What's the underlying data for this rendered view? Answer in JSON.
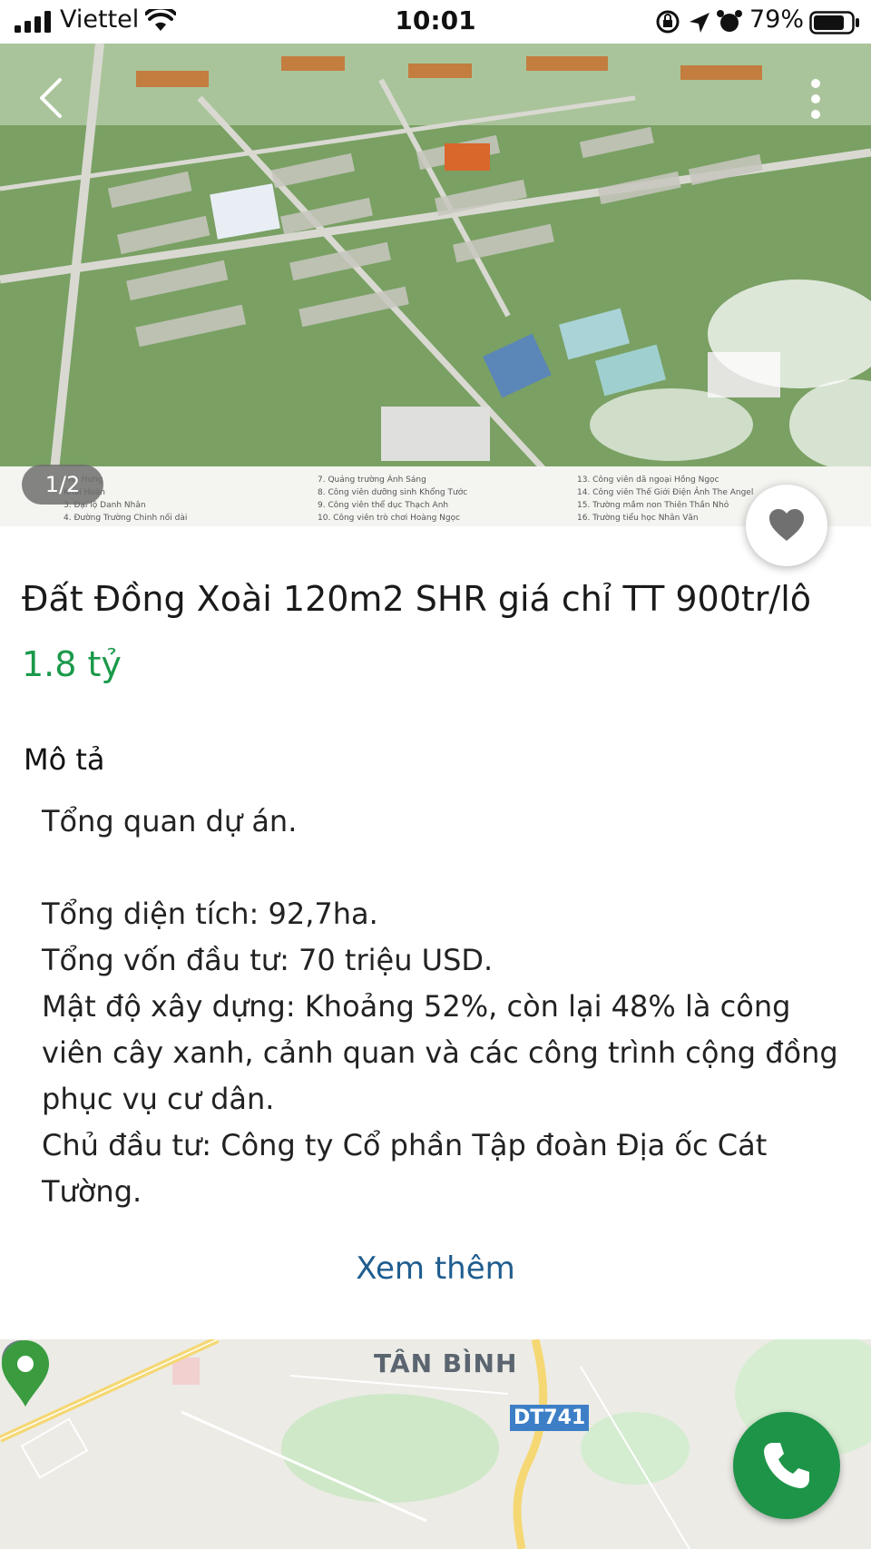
{
  "status_bar": {
    "carrier": "Viettel",
    "time": "10:01",
    "battery_percent": "79%"
  },
  "gallery": {
    "counter": "1/2",
    "legend_left": [
      "Phú Hưng",
      "Khải Hoàn",
      "3. Đại lộ Danh Nhân",
      "4. Đường Trường Chinh nối dài"
    ],
    "legend_mid": [
      "7. Quảng trường Ánh Sáng",
      "8. Công viên dưỡng sinh Khổng Tước",
      "9. Công viên thể dục Thạch Anh",
      "10. Công viên trò chơi Hoàng Ngọc"
    ],
    "legend_right": [
      "13. Công viên dã ngoại Hồng Ngọc",
      "14. Công viên Thế Giới Điện Ảnh The Angel",
      "15. Trường mầm non Thiên Thần Nhỏ",
      "16. Trường tiểu học Nhân Văn"
    ]
  },
  "listing": {
    "title": "Đất Đồng Xoài 120m2 SHR giá chỉ TT 900tr/lô",
    "price": "1.8 tỷ"
  },
  "description": {
    "heading": "Mô tả",
    "intro": "Tổng quan dự án.",
    "lines": [
      "Tổng diện tích: 92,7ha.",
      "Tổng vốn đầu tư: 70 triệu USD.",
      "Mật độ xây dựng: Khoảng 52%, còn lại 48% là công viên cây xanh, cảnh quan và các công trình cộng đồng phục vụ cư dân.",
      "Chủ đầu tư: Công ty Cổ phần Tập đoàn Địa ốc Cát Tường."
    ],
    "see_more": "Xem thêm"
  },
  "map": {
    "area_label": "TÂN BÌNH",
    "road_label": "DT741"
  },
  "colors": {
    "price_green": "#1a9a4a",
    "link_blue": "#1f5d8f",
    "call_green": "#1e9448"
  }
}
